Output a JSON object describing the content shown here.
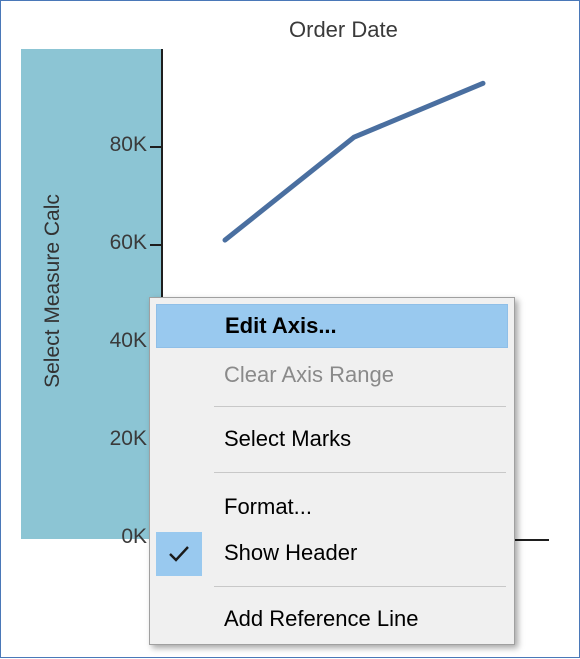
{
  "chart_data": {
    "type": "line",
    "title": "Order Date",
    "ylabel": "Select Measure Calc",
    "ylim": [
      0,
      100000
    ],
    "y_ticks": [
      "0K",
      "20K",
      "40K",
      "60K",
      "80K"
    ],
    "y_tick_values": [
      0,
      20000,
      40000,
      60000,
      80000
    ],
    "series": [
      {
        "values": [
          61000,
          82000,
          93000
        ]
      }
    ],
    "line_color": "#4a6fa0",
    "axis_pane_color": "#8cc5d4"
  },
  "context_menu": {
    "items": [
      {
        "label": "Edit Axis...",
        "state": "highlighted",
        "bold": true
      },
      {
        "label": "Clear Axis Range",
        "state": "disabled"
      },
      {
        "label": "Select Marks"
      },
      {
        "label": "Format..."
      },
      {
        "label": "Show Header",
        "checked": true
      },
      {
        "label": "Add Reference Line"
      }
    ],
    "check_icon": "checkmark-icon"
  }
}
